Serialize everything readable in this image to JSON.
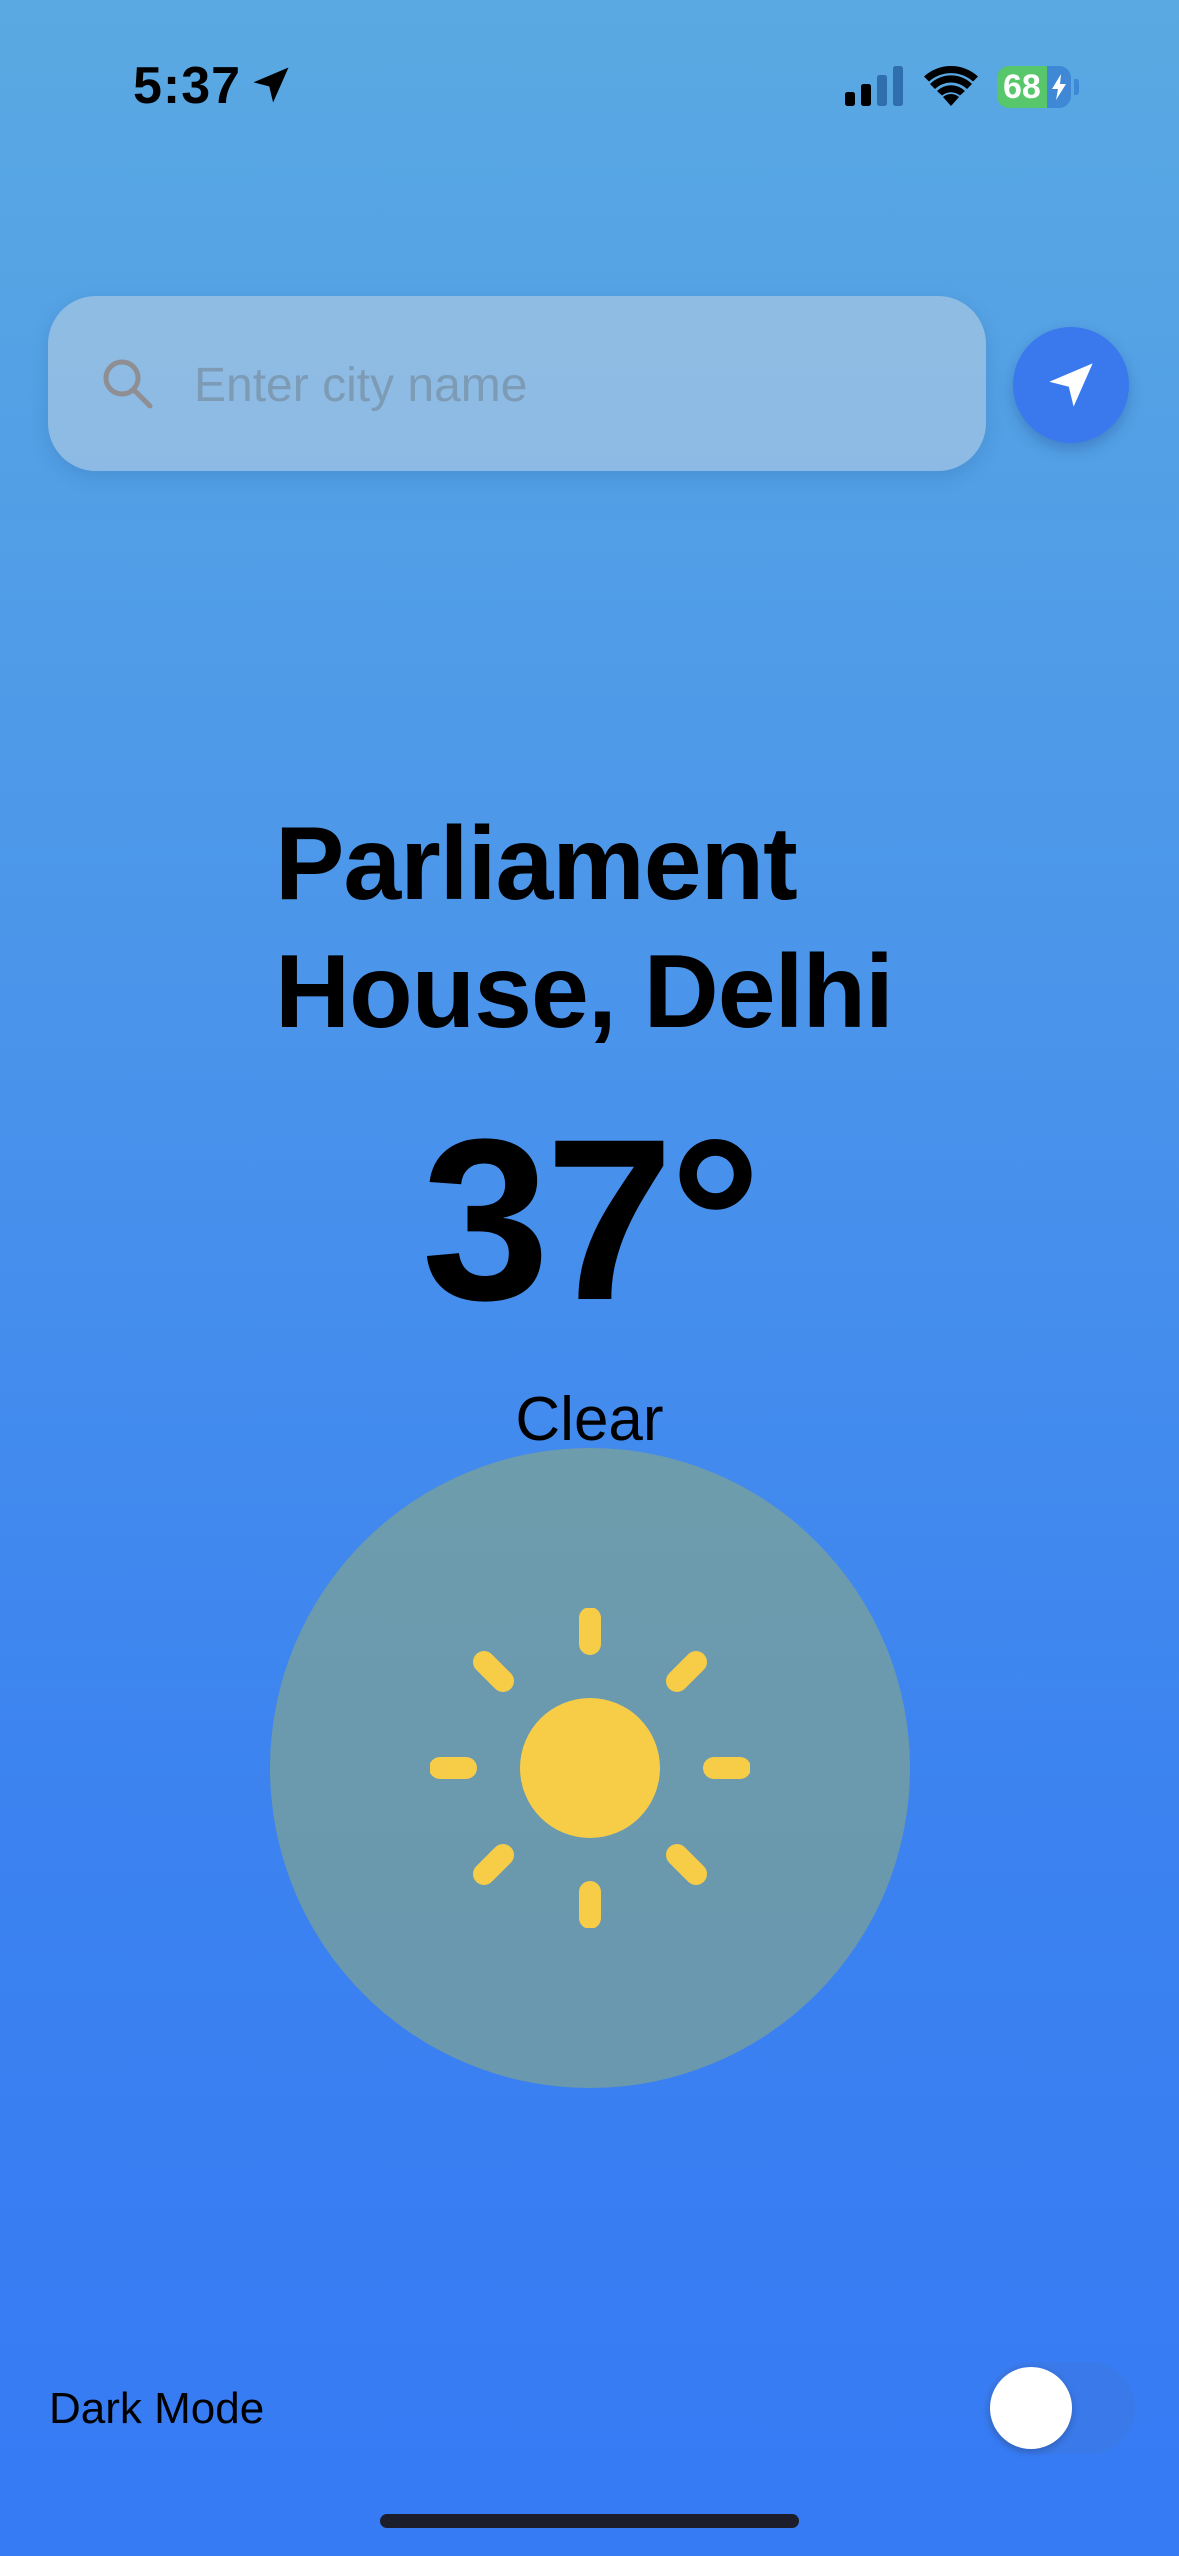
{
  "status_bar": {
    "time": "5:37",
    "battery_level": "68",
    "icons": [
      "location-arrow-icon",
      "signal-icon",
      "wifi-icon",
      "battery-icon"
    ]
  },
  "search": {
    "placeholder": "Enter city name",
    "value": ""
  },
  "locate_button": {
    "icon": "navigation-icon"
  },
  "weather": {
    "location_line1": "Parliament",
    "location_line2": "House, Delhi",
    "temperature": "37°",
    "condition": "Clear",
    "icon": "sun-icon"
  },
  "settings": {
    "dark_mode_label": "Dark Mode",
    "dark_mode_enabled": false
  },
  "colors": {
    "background_top": "#5aa9e2",
    "background_bottom": "#367af4",
    "accent_button": "#3a78ee",
    "sun": "#f7cd47",
    "weather_circle": "#8aa882",
    "battery_green": "#58c76b"
  }
}
